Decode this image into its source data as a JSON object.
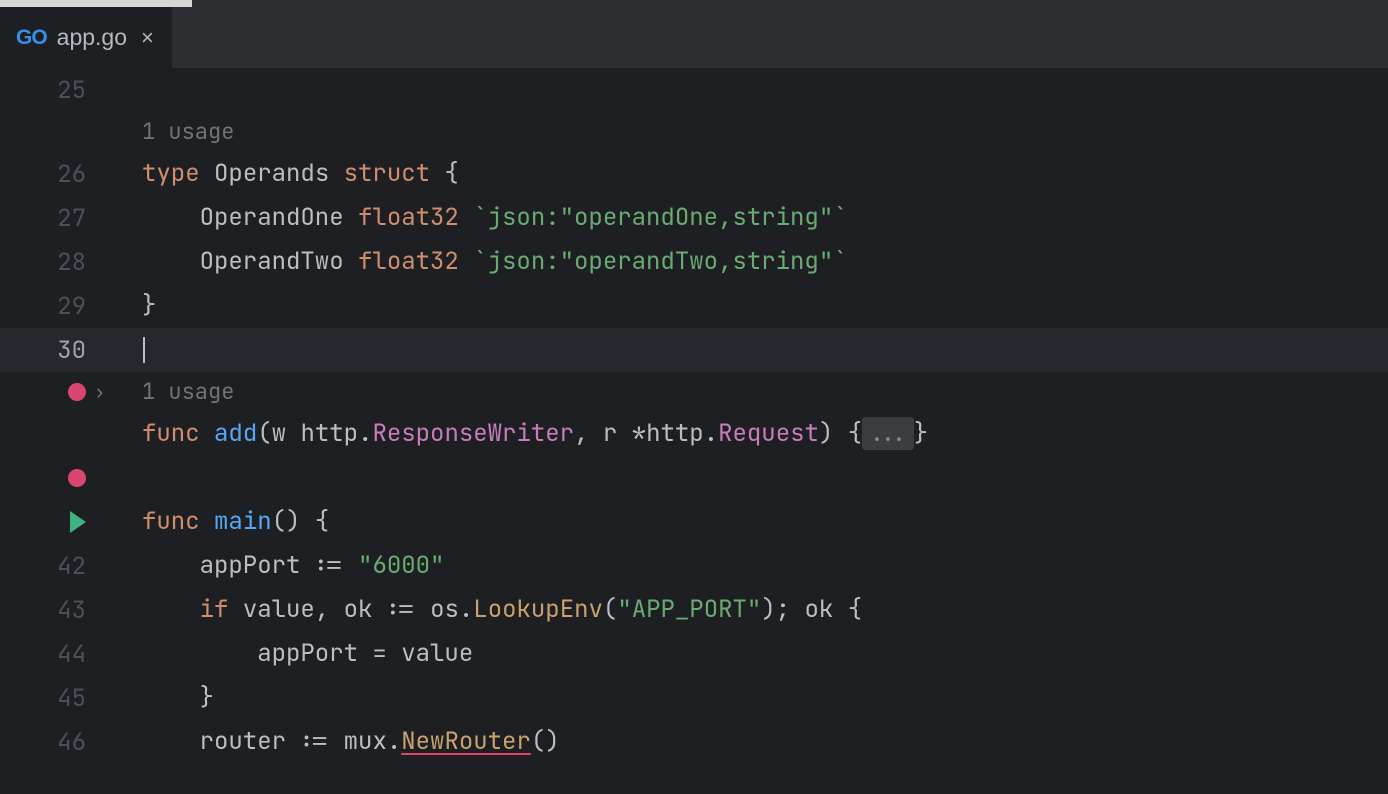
{
  "tab": {
    "icon_text": "GO",
    "filename": "app.go"
  },
  "usage": {
    "struct": "1 usage",
    "func": "1 usage"
  },
  "line_numbers": {
    "l25": "25",
    "l26": "26",
    "l27": "27",
    "l28": "28",
    "l29": "29",
    "l30": "30",
    "l42": "42",
    "l43": "43",
    "l44": "44",
    "l45": "45",
    "l46": "46"
  },
  "code": {
    "type_kw": "type",
    "struct_name": "Operands",
    "struct_kw": "struct",
    "open_brace": " {",
    "field1_name": "OperandOne",
    "field1_type": "float32",
    "field1_tag": "`json:\"operandOne,string\"`",
    "field2_name": "OperandTwo",
    "field2_type": "float32",
    "field2_tag": "`json:\"operandTwo,string\"`",
    "close_brace": "}",
    "func_kw": "func",
    "add_fn": "add",
    "w_param": "w",
    "http_pkg": "http",
    "rw_type": "ResponseWriter",
    "r_param": "r",
    "req_type": "Request",
    "folded": "...",
    "main_fn": "main",
    "appPort_var": "appPort",
    "assign": ":=",
    "port_str": "\"6000\"",
    "if_kw": "if",
    "value_var": "value",
    "ok_var": "ok",
    "os_pkg": "os",
    "lookup_fn": "LookupEnv",
    "app_port_str": "\"APP_PORT\"",
    "ok_cond": "; ok {",
    "eq": "=",
    "value_ref": "value",
    "router_var": "router",
    "mux_pkg": "mux",
    "new_router": "NewRouter",
    "paren_open": "(",
    "paren_close": ")",
    "star": "*",
    "dot": ".",
    "comma_sp": ", ",
    "brace_open": "{",
    "brace_close": "}",
    "paren_empty": "()",
    "space": " "
  }
}
